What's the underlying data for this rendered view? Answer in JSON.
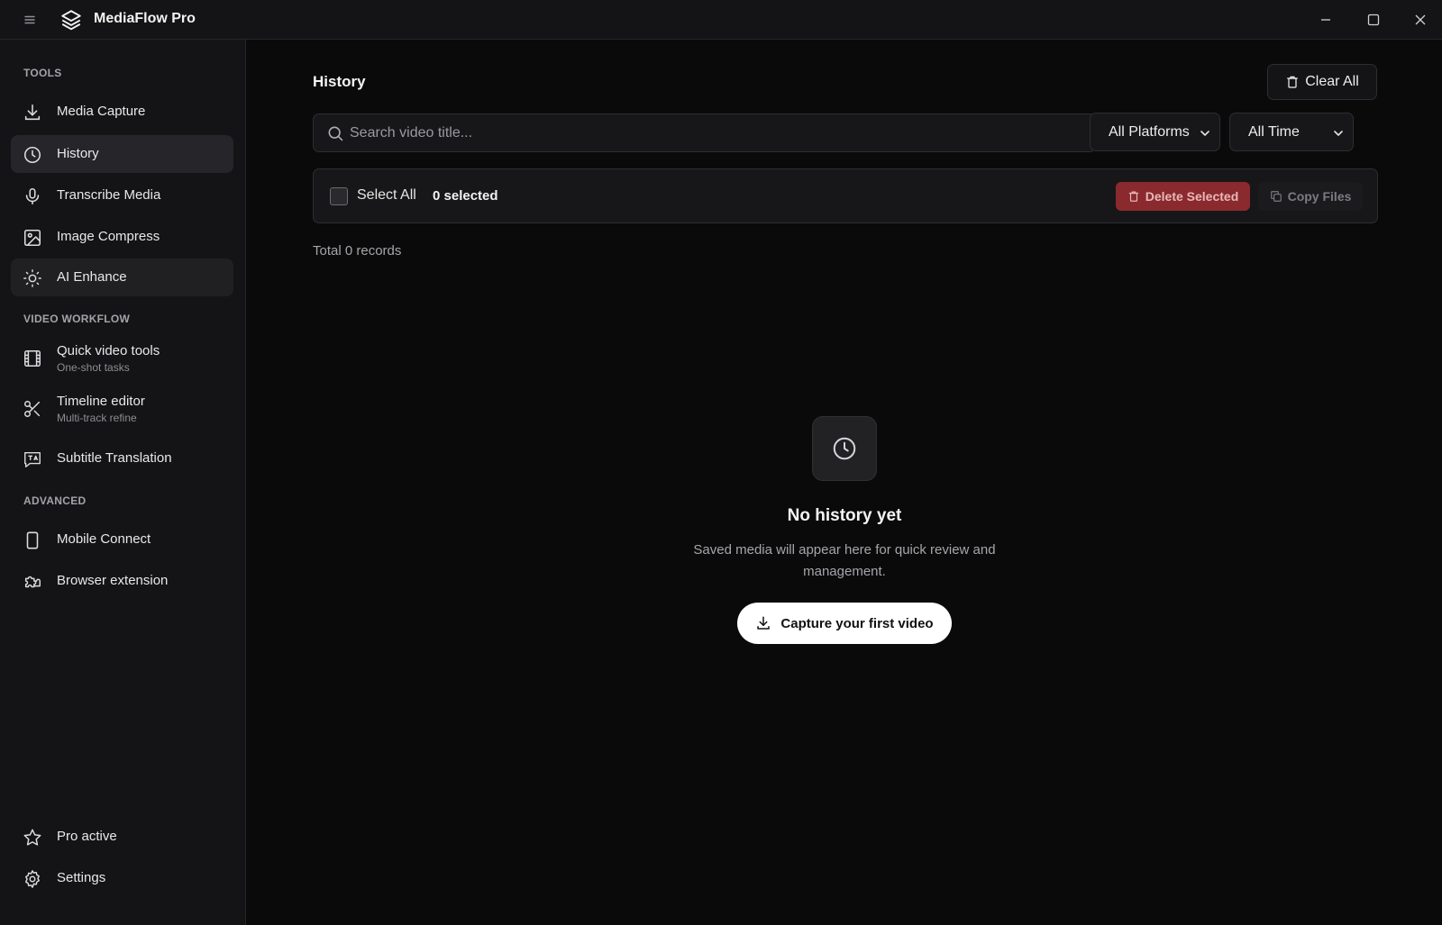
{
  "app": {
    "title": "MediaFlow Pro"
  },
  "sidebar": {
    "sections": [
      {
        "label": "TOOLS"
      },
      {
        "label": "VIDEO WORKFLOW"
      },
      {
        "label": "ADVANCED"
      }
    ],
    "tools": [
      {
        "label": "Media Capture",
        "icon": "download-icon"
      },
      {
        "label": "History",
        "icon": "clock-icon",
        "active": true
      },
      {
        "label": "Transcribe Media",
        "icon": "microphone-icon"
      },
      {
        "label": "Image Compress",
        "icon": "image-icon"
      },
      {
        "label": "AI Enhance",
        "icon": "sparkle-icon"
      }
    ],
    "video_workflow": [
      {
        "label": "Quick video tools",
        "sub": "One-shot tasks",
        "icon": "film-icon"
      },
      {
        "label": "Timeline editor",
        "sub": "Multi-track refine",
        "icon": "scissors-icon"
      },
      {
        "label": "Subtitle Translation",
        "icon": "translate-icon"
      }
    ],
    "advanced": [
      {
        "label": "Mobile Connect",
        "icon": "phone-icon"
      },
      {
        "label": "Browser extension",
        "icon": "puzzle-icon"
      }
    ],
    "footer": [
      {
        "label": "Pro active",
        "icon": "star-icon"
      },
      {
        "label": "Settings",
        "icon": "gear-icon"
      }
    ]
  },
  "main": {
    "title": "History",
    "clear_all": "Clear All",
    "search_placeholder": "Search video title...",
    "platform_filter": "All Platforms",
    "time_filter": "All Time",
    "select_all": "Select All",
    "selected_count": "0 selected",
    "delete_selected": "Delete Selected",
    "copy_files": "Copy Files",
    "total": "Total 0 records",
    "empty": {
      "title": "No history yet",
      "desc": "Saved media will appear here for quick review and management.",
      "cta": "Capture your first video"
    }
  },
  "colors": {
    "background": "#0a0a0b",
    "sidebar": "#141416",
    "active_item": "#26262a",
    "danger": "#8a2a2e",
    "primary_button": "#ffffff"
  }
}
